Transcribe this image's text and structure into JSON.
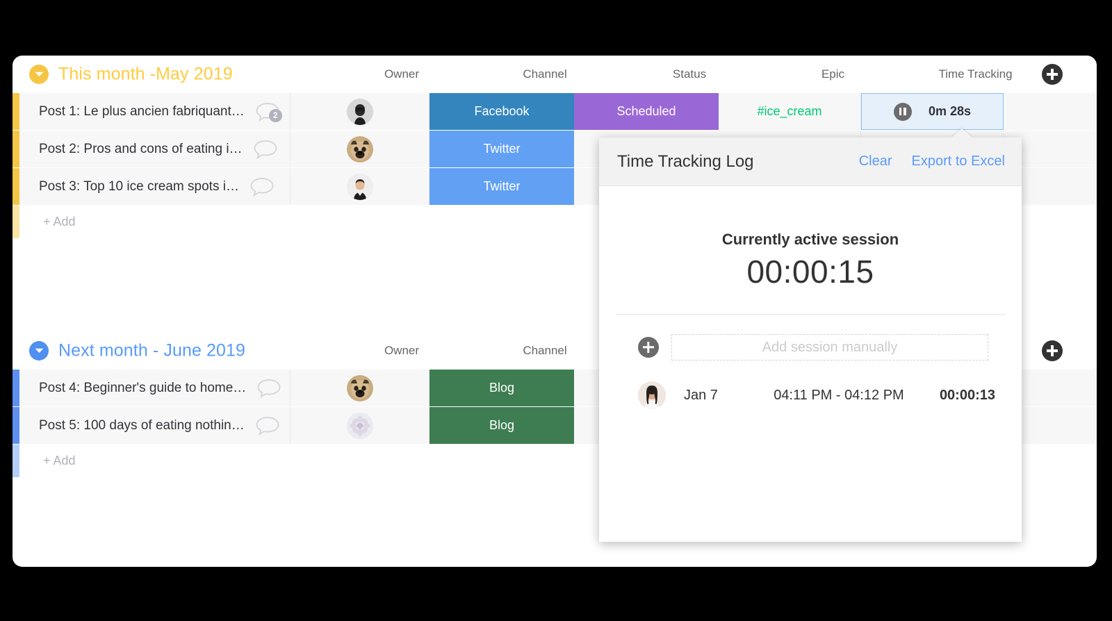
{
  "columns": [
    {
      "label": "Owner",
      "key": "owner"
    },
    {
      "label": "Channel",
      "key": "channel"
    },
    {
      "label": "Status",
      "key": "status"
    },
    {
      "label": "Epic",
      "key": "epic"
    },
    {
      "label": "Time Tracking",
      "key": "time"
    }
  ],
  "groups": [
    {
      "title": "This month -May 2019",
      "color": "#ffcb3d",
      "accent": "yellow",
      "collapse_icon": "chevron-down-icon",
      "add_label": "+ Add",
      "add_item_icon": "plus-circle-icon",
      "rows": [
        {
          "name": "Post 1: Le plus ancien fabriquant…",
          "comment_icon": "comment-bubble-icon",
          "comment_count": "2",
          "owner_avatar": "avatar-woman-glasses",
          "channel": "Facebook",
          "channel_color": "#3485bd",
          "status": "Scheduled",
          "status_color": "#9a67d6",
          "epic": "#ice_cream",
          "epic_color": "#00c875",
          "time": "0m 28s",
          "time_active": true,
          "time_icon": "pause-icon"
        },
        {
          "name": "Post 2: Pros and cons of eating i…",
          "comment_icon": "comment-bubble-icon",
          "comment_count": "",
          "owner_avatar": "avatar-pug-dog",
          "channel": "Twitter",
          "channel_color": "#62a0f4",
          "status": "",
          "status_color": "",
          "epic": "",
          "epic_color": "",
          "time": "",
          "time_active": false,
          "time_icon": ""
        },
        {
          "name": "Post 3: Top 10 ice cream spots i…",
          "comment_icon": "comment-bubble-icon",
          "comment_count": "",
          "owner_avatar": "avatar-man",
          "channel": "Twitter",
          "channel_color": "#62a0f4",
          "status": "",
          "status_color": "",
          "epic": "",
          "epic_color": "",
          "time": "",
          "time_active": false,
          "time_icon": ""
        }
      ]
    },
    {
      "title": "Next month - June 2019",
      "color": "#579bfc",
      "accent": "blue",
      "collapse_icon": "chevron-down-icon",
      "add_label": "+ Add",
      "add_item_icon": "plus-circle-icon",
      "rows": [
        {
          "name": "Post 4: Beginner's guide to home…",
          "comment_icon": "comment-bubble-icon",
          "comment_count": "",
          "owner_avatar": "avatar-pug-dog",
          "channel": "Blog",
          "channel_color": "#3d7d51",
          "status": "",
          "status_color": "",
          "epic": "",
          "epic_color": "",
          "time": "",
          "time_active": false,
          "time_icon": ""
        },
        {
          "name": "Post 5: 100 days of eating nothin…",
          "comment_icon": "comment-bubble-icon",
          "comment_count": "",
          "owner_avatar": "avatar-flower",
          "channel": "Blog",
          "channel_color": "#3d7d51",
          "status": "",
          "status_color": "",
          "epic": "",
          "epic_color": "",
          "time": "",
          "time_active": false,
          "time_icon": ""
        }
      ]
    }
  ],
  "popup": {
    "title": "Time Tracking Log",
    "clear_label": "Clear",
    "export_label": "Export to Excel",
    "active_label": "Currently active session",
    "active_timer": "00:00:15",
    "add_manually_placeholder": "Add session manually",
    "add_manually_icon": "plus-circle-icon",
    "sessions": [
      {
        "avatar": "avatar-woman-long-hair",
        "date": "Jan 7",
        "range": "04:11 PM - 04:12 PM",
        "duration": "00:00:13"
      }
    ]
  }
}
